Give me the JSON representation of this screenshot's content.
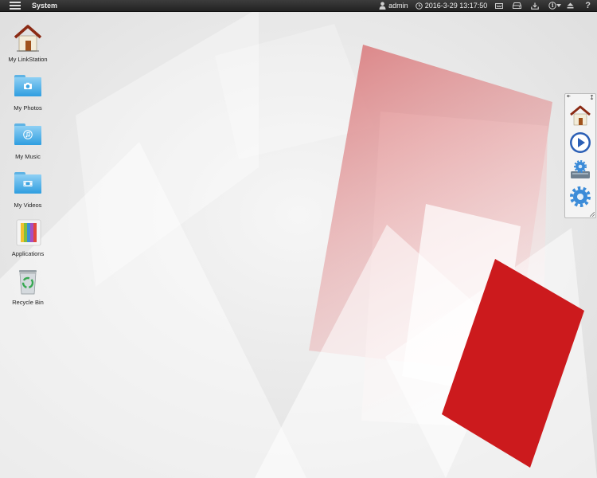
{
  "topbar": {
    "title": "System",
    "user": "admin",
    "datetime": "2016-3-29 13:17:50",
    "icons": [
      "user-icon",
      "clock-icon",
      "keyboard-icon",
      "drive-icon",
      "download-icon",
      "info-icon",
      "eject-icon",
      "help-icon"
    ],
    "help_glyph": "?",
    "info_glyph": "i"
  },
  "desktop": {
    "icons": [
      {
        "label": "My LinkStation",
        "icon": "house-icon"
      },
      {
        "label": "My Photos",
        "icon": "camera-folder-icon"
      },
      {
        "label": "My Music",
        "icon": "music-folder-icon"
      },
      {
        "label": "My Videos",
        "icon": "video-folder-icon"
      },
      {
        "label": "Applications",
        "icon": "applications-icon"
      },
      {
        "label": "Recycle Bin",
        "icon": "recycle-bin-icon"
      }
    ]
  },
  "dock": {
    "items": [
      "house-icon",
      "play-icon",
      "drive-settings-icon",
      "gear-icon"
    ]
  },
  "colors": {
    "accent_red": "#c8161b",
    "topbar": "#2b2b2b",
    "folder_blue": "#3aa3e2"
  }
}
